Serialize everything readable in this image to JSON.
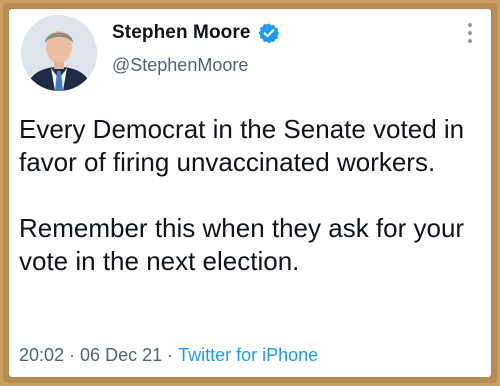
{
  "user": {
    "display_name": "Stephen Moore",
    "handle": "@StephenMoore",
    "verified": true,
    "avatar": "avatar-photo",
    "verified_icon": "verified-badge-icon",
    "menu_icon": "more-vertical-icon"
  },
  "tweet": {
    "paragraphs": [
      "Every Democrat in the Senate voted in favor of firing unvaccinated workers.",
      "Remember this when they ask for your vote in the next election."
    ]
  },
  "meta": {
    "time": "20:02",
    "separator": "·",
    "date": "06 Dec 21",
    "source": "Twitter for iPhone"
  },
  "colors": {
    "text": "#0f1419",
    "secondary": "#536471",
    "accent": "#1d9bf0",
    "frame": "#c9a063"
  }
}
